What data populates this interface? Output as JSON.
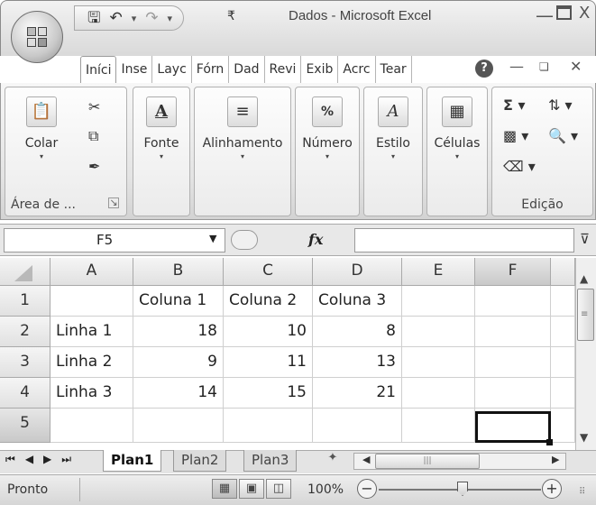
{
  "window": {
    "title": "Dados - Microsoft Excel",
    "min_glyph": "—",
    "close_glyph": "X"
  },
  "qat": {
    "save_icon": "save-icon",
    "undo_icon": "undo-icon",
    "redo_icon": "redo-icon"
  },
  "ribbon": {
    "tabs": [
      "Iníci",
      "Inse",
      "Layc",
      "Fórn",
      "Dad",
      "Revi",
      "Exib",
      "Acrc",
      "Tear"
    ],
    "active_tab_index": 0,
    "groups": {
      "clipboard": {
        "paste_label": "Colar",
        "group_label": "Área de ..."
      },
      "font": {
        "label": "Fonte"
      },
      "alignment": {
        "label": "Alinhamento"
      },
      "number": {
        "label": "Número"
      },
      "style": {
        "label": "Estilo"
      },
      "cells": {
        "label": "Células"
      },
      "editing": {
        "label": "Edição"
      }
    }
  },
  "formula_bar": {
    "name_box": "F5",
    "fx_label": "fx",
    "formula": ""
  },
  "sheet": {
    "columns": [
      "A",
      "B",
      "C",
      "D",
      "E",
      "F"
    ],
    "rows": [
      "1",
      "2",
      "3",
      "4",
      "5"
    ],
    "cells": [
      [
        "",
        "Coluna 1",
        "Coluna 2",
        "Coluna 3",
        "",
        ""
      ],
      [
        "Linha 1",
        "18",
        "10",
        "8",
        "",
        ""
      ],
      [
        "Linha 2",
        "9",
        "11",
        "13",
        "",
        ""
      ],
      [
        "Linha 3",
        "14",
        "15",
        "21",
        "",
        ""
      ],
      [
        "",
        "",
        "",
        "",
        "",
        ""
      ]
    ],
    "active_cell": "F5",
    "tabs": [
      "Plan1",
      "Plan2",
      "Plan3"
    ],
    "active_tab": "Plan1"
  },
  "status": {
    "text": "Pronto",
    "zoom": "100%",
    "zoom_out": "−",
    "zoom_in": "+"
  }
}
